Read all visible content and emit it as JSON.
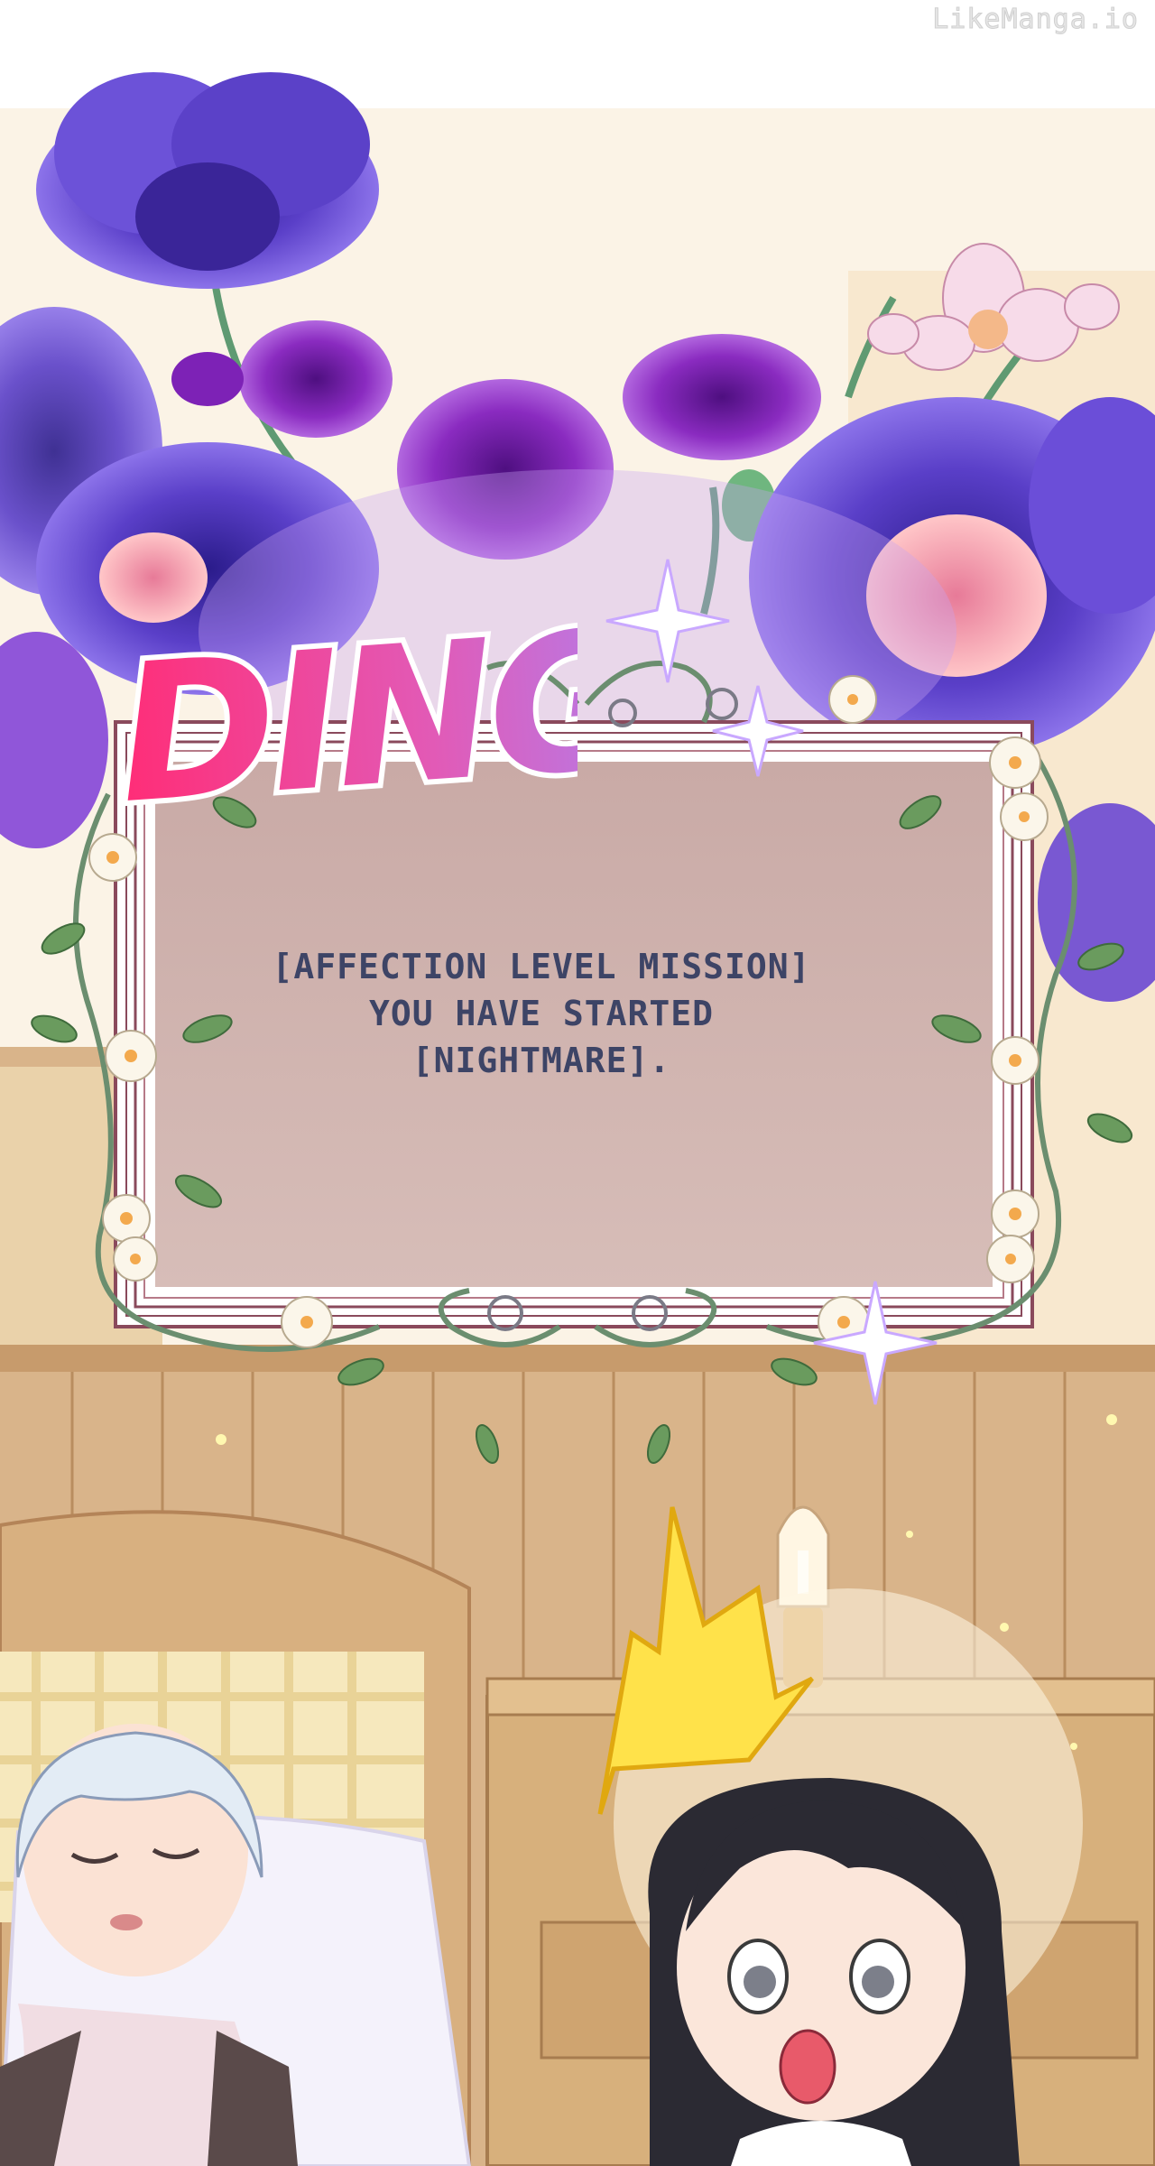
{
  "watermark": "LikeManga.io",
  "sound_effect": "DING",
  "system_window": {
    "line_1": "[AFFECTION LEVEL MISSION]",
    "line_2": "YOU HAVE STARTED",
    "line_3": "[NIGHTMARE]."
  },
  "palette": {
    "wall": "#fbf3e6",
    "wood": "#d9b48a",
    "wood_dark": "#b98d5f",
    "panel": "#c9aaa6",
    "panel_border": "#8a4a5c",
    "flower_blue": "#5a3fc8",
    "flower_purple": "#8a2bc0",
    "flower_pink": "#f3a7b7",
    "ding_pink": "#ff2d77",
    "ding_lilac": "#b57be8",
    "halo_yellow": "#ffe24a"
  }
}
